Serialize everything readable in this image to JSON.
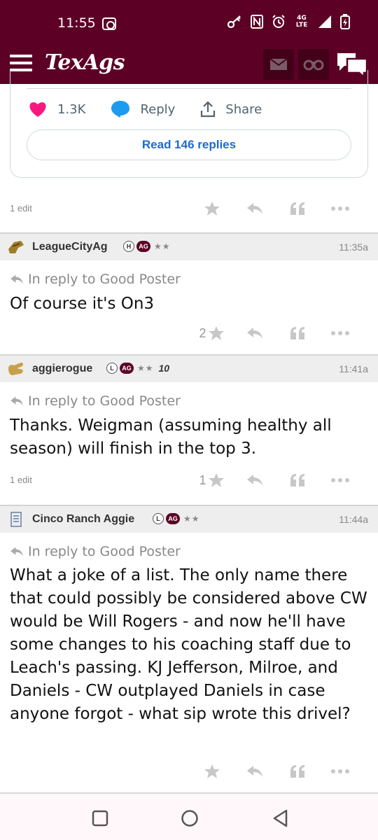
{
  "status_bar": {
    "time": "11:55",
    "network": "4G LTE"
  },
  "header": {
    "logo_text": "TexAgs",
    "mail_icon": "mail-icon",
    "binoculars_icon": "binoculars-icon",
    "chat_icon": "chat-icon"
  },
  "embed": {
    "like_count": "1.3K",
    "reply_label": "Reply",
    "share_label": "Share",
    "read_replies_label": "Read 146 replies"
  },
  "posts": [
    {
      "edit_note": "1 edit",
      "star_count": ""
    },
    {
      "username": "LeagueCityAg",
      "badge_letter": "H",
      "badge_ag": "AG",
      "stars": "★★",
      "time": "11:35a",
      "reply_to": "In reply to Good Poster",
      "text": "Of course it's On3",
      "star_count": "2",
      "edit_note": ""
    },
    {
      "username": "aggierogue",
      "badge_letter": "L",
      "badge_ag": "AG",
      "stars": "★★",
      "extra_badge": "10",
      "time": "11:41a",
      "reply_to": "In reply to Good Poster",
      "text": "Thanks. Weigman (assuming healthy all season) will finish in the top 3.",
      "star_count": "1",
      "edit_note": "1 edit"
    },
    {
      "username": "Cinco Ranch Aggie",
      "badge_letter": "L",
      "badge_ag": "AG",
      "stars": "★★",
      "time": "11:44a",
      "reply_to": "In reply to Good Poster",
      "text": "What a joke of a list. The only name there that could possibly be considered above CW would be Will Rogers - and now he'll have some changes to his coaching staff due to Leach's passing. KJ Jefferson, Milroe, and Daniels - CW outplayed Daniels in case anyone forgot - what sip wrote this drivel?",
      "star_count": "",
      "edit_note": ""
    }
  ],
  "colors": {
    "brand": "#5d0025",
    "link": "#1d6bd0",
    "heart": "#f91880"
  }
}
